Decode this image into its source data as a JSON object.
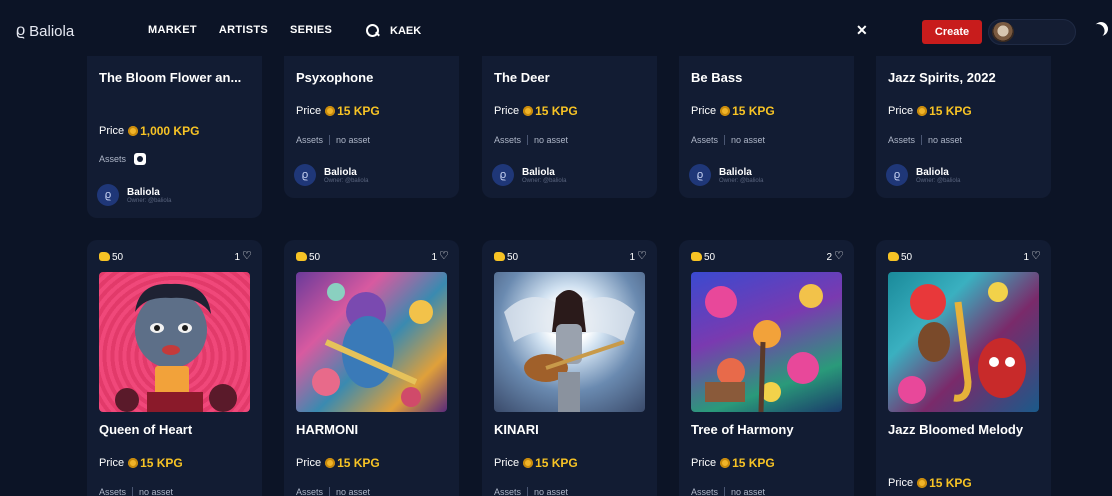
{
  "header": {
    "logo": "Baliola",
    "nav": [
      "MARKET",
      "ARTISTS",
      "SERIES"
    ],
    "search_value": "KAEK",
    "clear_label": "✕",
    "create_label": "Create"
  },
  "top_cards": [
    {
      "title": "The Bloom Flower an...",
      "price_label": "Price",
      "price": "1,000 KPG",
      "assets_label": "Assets",
      "assets_value": "",
      "owner": "Baliola",
      "owner_handle": "Owner: @baliola"
    },
    {
      "title": "Psyxophone",
      "price_label": "Price",
      "price": "15 KPG",
      "assets_label": "Assets",
      "assets_value": "no asset",
      "owner": "Baliola",
      "owner_handle": "Owner: @baliola"
    },
    {
      "title": "The Deer",
      "price_label": "Price",
      "price": "15 KPG",
      "assets_label": "Assets",
      "assets_value": "no asset",
      "owner": "Baliola",
      "owner_handle": "Owner: @baliola"
    },
    {
      "title": "Be Bass",
      "price_label": "Price",
      "price": "15 KPG",
      "assets_label": "Assets",
      "assets_value": "no asset",
      "owner": "Baliola",
      "owner_handle": "Owner: @baliola"
    },
    {
      "title": "Jazz Spirits, 2022",
      "price_label": "Price",
      "price": "15 KPG",
      "assets_label": "Assets",
      "assets_value": "no asset",
      "owner": "Baliola",
      "owner_handle": "Owner: @baliola"
    }
  ],
  "bottom_cards": [
    {
      "supply": "50",
      "likes": "1",
      "title": "Queen of Heart",
      "price_label": "Price",
      "price": "15 KPG",
      "assets_label": "Assets",
      "assets_value": "no asset"
    },
    {
      "supply": "50",
      "likes": "1",
      "title": "HARMONI",
      "price_label": "Price",
      "price": "15 KPG",
      "assets_label": "Assets",
      "assets_value": "no asset"
    },
    {
      "supply": "50",
      "likes": "1",
      "title": "KINARI",
      "price_label": "Price",
      "price": "15 KPG",
      "assets_label": "Assets",
      "assets_value": "no asset"
    },
    {
      "supply": "50",
      "likes": "2",
      "title": "Tree of Harmony",
      "price_label": "Price",
      "price": "15 KPG",
      "assets_label": "Assets",
      "assets_value": "no asset"
    },
    {
      "supply": "50",
      "likes": "1",
      "title": "Jazz Bloomed Melody",
      "price_label": "Price",
      "price": "15 KPG",
      "assets_label": "",
      "assets_value": ""
    }
  ],
  "colors": {
    "background": "#0c1426",
    "card": "#121c33",
    "accent_price": "#f7c325",
    "create_button": "#c81c1c"
  }
}
